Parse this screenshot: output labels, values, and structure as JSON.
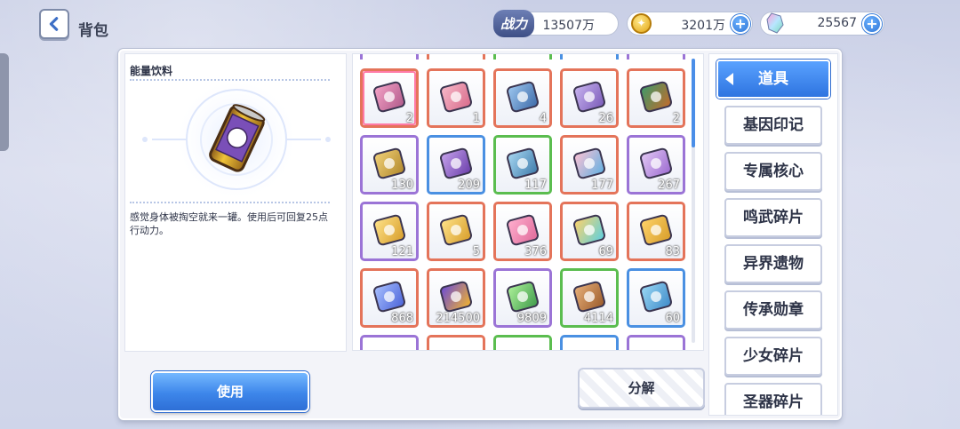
{
  "header": {
    "title": "背包",
    "power_label": "战力",
    "power_value": "13507万",
    "coins_value": "3201万",
    "gems_value": "25567"
  },
  "detail": {
    "name": "能量饮料",
    "description": "感觉身体被掏空就来一罐。使用后可回复25点行动力。"
  },
  "grid": {
    "items": [
      {
        "icon": "pink-device-icon",
        "count": "2",
        "border": "#e4745a",
        "selected": true
      },
      {
        "icon": "ticket-icon",
        "count": "1",
        "border": "#e4745a"
      },
      {
        "icon": "orb-icon",
        "count": "4",
        "border": "#e4745a"
      },
      {
        "icon": "potion-bottle-icon",
        "count": "26",
        "border": "#e4745a"
      },
      {
        "icon": "treasure-pot-icon",
        "count": "2",
        "border": "#e4745a"
      },
      {
        "icon": "golden-mask-icon",
        "count": "130",
        "border": "#9b74d6"
      },
      {
        "icon": "purple-mask-icon",
        "count": "209",
        "border": "#4a90e2"
      },
      {
        "icon": "green-mask-icon",
        "count": "117",
        "border": "#5bbd4f"
      },
      {
        "icon": "pink-ticket-icon",
        "count": "177",
        "border": "#e4745a"
      },
      {
        "icon": "smile-ticket-icon",
        "count": "267",
        "border": "#9b74d6"
      },
      {
        "icon": "dna-card-icon",
        "count": "121",
        "border": "#9b74d6"
      },
      {
        "icon": "gold-card-icon",
        "count": "5",
        "border": "#e4745a"
      },
      {
        "icon": "pink-dna-card-icon",
        "count": "376",
        "border": "#e4745a"
      },
      {
        "icon": "rainbow-ticket-icon",
        "count": "69",
        "border": "#e4745a"
      },
      {
        "icon": "sword-card-icon",
        "count": "83",
        "border": "#e4745a"
      },
      {
        "icon": "blue-card-icon",
        "count": "868",
        "border": "#e4745a"
      },
      {
        "icon": "crystal-icon",
        "count": "214500",
        "border": "#e4745a"
      },
      {
        "icon": "green-tube-icon",
        "count": "9809",
        "border": "#9b74d6"
      },
      {
        "icon": "cookie-icon",
        "count": "4114",
        "border": "#5bbd4f"
      },
      {
        "icon": "candy-icon",
        "count": "60",
        "border": "#4a90e2"
      }
    ],
    "partial_row_borders": [
      "#9b74d6",
      "#e4745a",
      "#5bbd4f",
      "#4a90e2",
      "#9b74d6"
    ]
  },
  "categories": [
    {
      "label": "道具",
      "active": true
    },
    {
      "label": "基因印记"
    },
    {
      "label": "专属核心"
    },
    {
      "label": "鸣武碎片"
    },
    {
      "label": "异界遗物"
    },
    {
      "label": "传承勋章"
    },
    {
      "label": "少女碎片"
    },
    {
      "label": "圣器碎片"
    }
  ],
  "buttons": {
    "use": "使用",
    "decompose": "分解"
  }
}
